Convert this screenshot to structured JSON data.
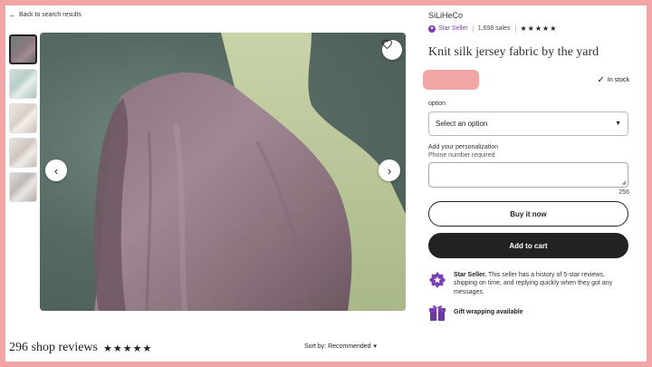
{
  "nav": {
    "back_label": "Back to search results"
  },
  "gallery": {
    "thumbnails": [
      "thumb-1",
      "thumb-2",
      "thumb-3",
      "thumb-4",
      "thumb-5"
    ],
    "active_index": 0
  },
  "shop": {
    "name": "SiLiHeCo",
    "star_seller_label": "Star Seller",
    "sales": "1,658 sales",
    "rating_stars": "★★★★★"
  },
  "listing": {
    "title": "Knit silk jersey fabric by the yard",
    "stock_label": "In stock"
  },
  "options": {
    "label": "option",
    "select_value": "Select an option"
  },
  "personalization": {
    "label": "Add your personalization",
    "hint": "Phone number required",
    "char_count": "256"
  },
  "actions": {
    "buy_now": "Buy it now",
    "add_to_cart": "Add to cart"
  },
  "star_seller_info": {
    "title": "Star Seller.",
    "text": " This seller has a history of 5-star reviews, shipping on time, and replying quickly when they got any messages."
  },
  "gift": {
    "label": "Gift wrapping available"
  },
  "reviews": {
    "title": "296 shop reviews",
    "stars": "★★★★★",
    "sort_label": "Sort by: Recommended"
  },
  "colors": {
    "accent_purple": "#7b3fb3",
    "frame_pink": "#f2a5a5",
    "button_dark": "#222222"
  },
  "icons": {
    "back": "arrow-left-icon",
    "favorite": "heart-icon",
    "prev": "chevron-left-icon",
    "next": "chevron-right-icon",
    "stock": "check-icon",
    "caret": "caret-down-icon",
    "star_seller": "star-seller-badge-icon",
    "gift": "gift-icon"
  }
}
